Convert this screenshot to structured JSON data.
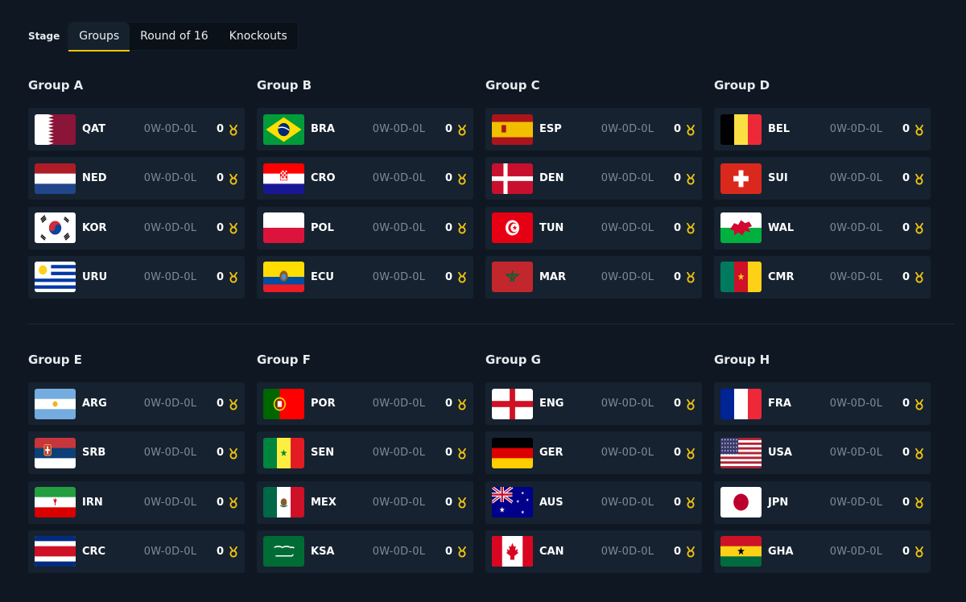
{
  "stage": {
    "label": "Stage",
    "tabs": [
      "Groups",
      "Round of 16",
      "Knockouts"
    ],
    "active_tab": "Groups"
  },
  "accent_color": "#f1c40f",
  "groups": [
    {
      "name": "Group A",
      "teams": [
        {
          "code": "QAT",
          "flag": "qatar-flag",
          "record": "0W-0D-0L",
          "points": "0"
        },
        {
          "code": "NED",
          "flag": "netherlands-flag",
          "record": "0W-0D-0L",
          "points": "0"
        },
        {
          "code": "KOR",
          "flag": "south-korea-flag",
          "record": "0W-0D-0L",
          "points": "0"
        },
        {
          "code": "URU",
          "flag": "uruguay-flag",
          "record": "0W-0D-0L",
          "points": "0"
        }
      ]
    },
    {
      "name": "Group B",
      "teams": [
        {
          "code": "BRA",
          "flag": "brazil-flag",
          "record": "0W-0D-0L",
          "points": "0"
        },
        {
          "code": "CRO",
          "flag": "croatia-flag",
          "record": "0W-0D-0L",
          "points": "0"
        },
        {
          "code": "POL",
          "flag": "poland-flag",
          "record": "0W-0D-0L",
          "points": "0"
        },
        {
          "code": "ECU",
          "flag": "ecuador-flag",
          "record": "0W-0D-0L",
          "points": "0"
        }
      ]
    },
    {
      "name": "Group C",
      "teams": [
        {
          "code": "ESP",
          "flag": "spain-flag",
          "record": "0W-0D-0L",
          "points": "0"
        },
        {
          "code": "DEN",
          "flag": "denmark-flag",
          "record": "0W-0D-0L",
          "points": "0"
        },
        {
          "code": "TUN",
          "flag": "tunisia-flag",
          "record": "0W-0D-0L",
          "points": "0"
        },
        {
          "code": "MAR",
          "flag": "morocco-flag",
          "record": "0W-0D-0L",
          "points": "0"
        }
      ]
    },
    {
      "name": "Group D",
      "teams": [
        {
          "code": "BEL",
          "flag": "belgium-flag",
          "record": "0W-0D-0L",
          "points": "0"
        },
        {
          "code": "SUI",
          "flag": "switzerland-flag",
          "record": "0W-0D-0L",
          "points": "0"
        },
        {
          "code": "WAL",
          "flag": "wales-flag",
          "record": "0W-0D-0L",
          "points": "0"
        },
        {
          "code": "CMR",
          "flag": "cameroon-flag",
          "record": "0W-0D-0L",
          "points": "0"
        }
      ]
    },
    {
      "name": "Group E",
      "teams": [
        {
          "code": "ARG",
          "flag": "argentina-flag",
          "record": "0W-0D-0L",
          "points": "0"
        },
        {
          "code": "SRB",
          "flag": "serbia-flag",
          "record": "0W-0D-0L",
          "points": "0"
        },
        {
          "code": "IRN",
          "flag": "iran-flag",
          "record": "0W-0D-0L",
          "points": "0"
        },
        {
          "code": "CRC",
          "flag": "costa-rica-flag",
          "record": "0W-0D-0L",
          "points": "0"
        }
      ]
    },
    {
      "name": "Group F",
      "teams": [
        {
          "code": "POR",
          "flag": "portugal-flag",
          "record": "0W-0D-0L",
          "points": "0"
        },
        {
          "code": "SEN",
          "flag": "senegal-flag",
          "record": "0W-0D-0L",
          "points": "0"
        },
        {
          "code": "MEX",
          "flag": "mexico-flag",
          "record": "0W-0D-0L",
          "points": "0"
        },
        {
          "code": "KSA",
          "flag": "saudi-arabia-flag",
          "record": "0W-0D-0L",
          "points": "0"
        }
      ]
    },
    {
      "name": "Group G",
      "teams": [
        {
          "code": "ENG",
          "flag": "england-flag",
          "record": "0W-0D-0L",
          "points": "0"
        },
        {
          "code": "GER",
          "flag": "germany-flag",
          "record": "0W-0D-0L",
          "points": "0"
        },
        {
          "code": "AUS",
          "flag": "australia-flag",
          "record": "0W-0D-0L",
          "points": "0"
        },
        {
          "code": "CAN",
          "flag": "canada-flag",
          "record": "0W-0D-0L",
          "points": "0"
        }
      ]
    },
    {
      "name": "Group H",
      "teams": [
        {
          "code": "FRA",
          "flag": "france-flag",
          "record": "0W-0D-0L",
          "points": "0"
        },
        {
          "code": "USA",
          "flag": "usa-flag",
          "record": "0W-0D-0L",
          "points": "0"
        },
        {
          "code": "JPN",
          "flag": "japan-flag",
          "record": "0W-0D-0L",
          "points": "0"
        },
        {
          "code": "GHA",
          "flag": "ghana-flag",
          "record": "0W-0D-0L",
          "points": "0"
        }
      ]
    }
  ]
}
